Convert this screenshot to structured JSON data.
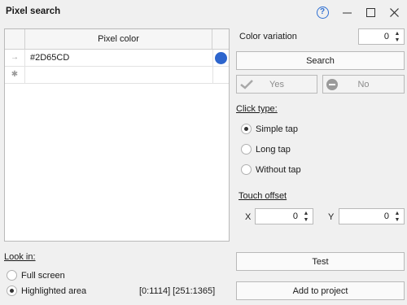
{
  "window": {
    "title": "Pixel search",
    "help_glyph": "?",
    "minimize_glyph": "—",
    "maximize_glyph": "☐",
    "close_glyph": "✕"
  },
  "grid": {
    "column_header": "Pixel color",
    "rows": [
      {
        "indicator": "→",
        "value": "#2D65CD",
        "color": "#2D65CD"
      },
      {
        "indicator": "✱",
        "value": "",
        "color": ""
      }
    ]
  },
  "color_variation": {
    "label": "Color variation",
    "value": "0"
  },
  "buttons": {
    "search": "Search",
    "yes": "Yes",
    "no": "No",
    "test": "Test",
    "add_to_project": "Add to project"
  },
  "click_type": {
    "label": "Click type:",
    "options": [
      "Simple tap",
      "Long tap",
      "Without tap"
    ],
    "selected": "Simple tap"
  },
  "touch_offset": {
    "label": "Touch offset",
    "x_label": "X",
    "x_value": "0",
    "y_label": "Y",
    "y_value": "0"
  },
  "look_in": {
    "label": "Look in:",
    "options": [
      "Full screen",
      "Highlighted area"
    ],
    "selected": "Highlighted area",
    "area": "[0:1114] [251:1365]"
  },
  "spin_up": "▲",
  "spin_down": "▼"
}
